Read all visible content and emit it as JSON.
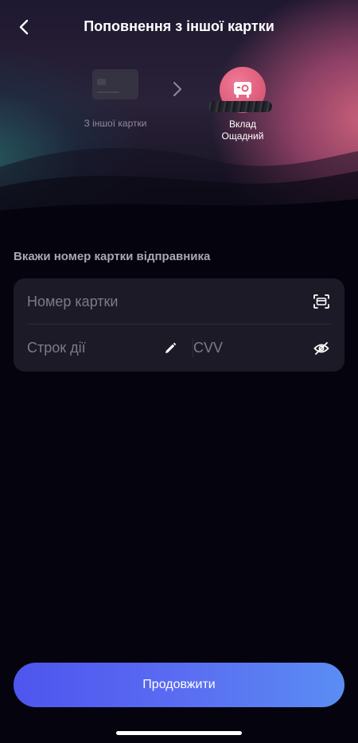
{
  "header": {
    "title": "Поповнення з іншої картки",
    "back_icon": "chevron-left-icon"
  },
  "flow": {
    "from_label": "З іншої картки",
    "to_label_line1": "Вклад",
    "to_label_line2": "Ощадний",
    "to_icon": "safe-icon",
    "arrow_icon": "chevron-right-icon"
  },
  "form": {
    "section_title": "Вкажи номер картки відправника",
    "card_number_placeholder": "Номер картки",
    "expiry_placeholder": "Строк дії",
    "cvv_placeholder": "CVV",
    "scan_icon": "scan-card-icon",
    "pencil_icon": "pencil-icon",
    "eye_icon": "eye-off-icon"
  },
  "actions": {
    "continue_label": "Продовжити"
  },
  "colors": {
    "accent_start": "#4e55ee",
    "accent_end": "#5a8df3",
    "deposit_icon": "#e0607c",
    "background": "#05040e"
  }
}
